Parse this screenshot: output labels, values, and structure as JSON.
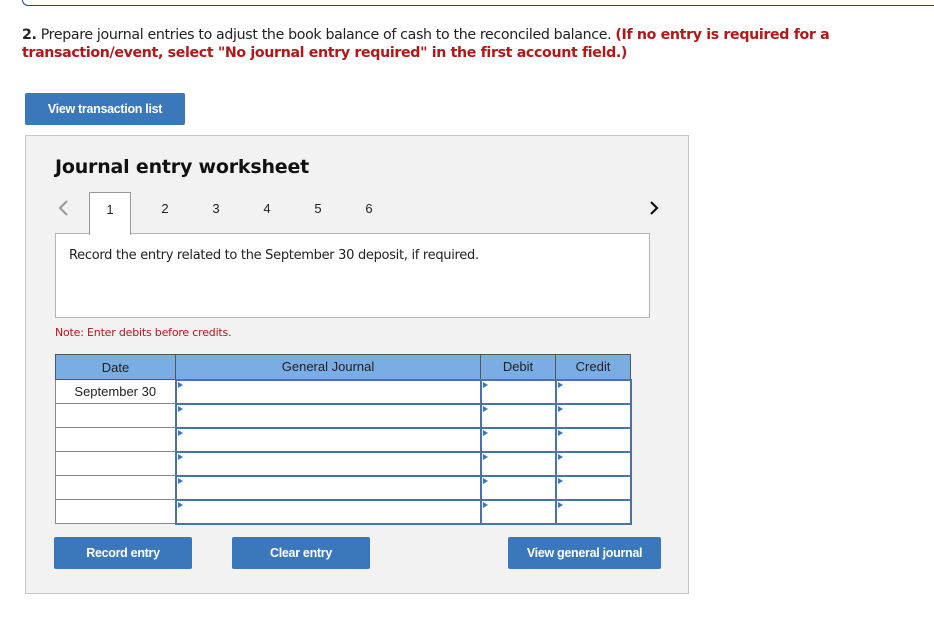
{
  "question": {
    "number": "2.",
    "text": " Prepare journal entries to adjust the book balance of cash to the reconciled balance. ",
    "instruction": "(If no entry is required for a transaction/event, select \"No journal entry required\" in the first account field.)"
  },
  "buttons": {
    "view_transaction_list": "View transaction list",
    "record_entry": "Record entry",
    "clear_entry": "Clear entry",
    "view_general_journal": "View general journal"
  },
  "worksheet": {
    "title": "Journal entry worksheet",
    "tabs": [
      "1",
      "2",
      "3",
      "4",
      "5",
      "6"
    ],
    "active_tab": "1",
    "prompt": "Record the entry related to the September 30 deposit, if required.",
    "note": "Note: Enter debits before credits."
  },
  "journal": {
    "headers": {
      "date": "Date",
      "account": "General Journal",
      "debit": "Debit",
      "credit": "Credit"
    },
    "rows": [
      {
        "date": "September 30",
        "account": "",
        "debit": "",
        "credit": ""
      },
      {
        "date": "",
        "account": "",
        "debit": "",
        "credit": ""
      },
      {
        "date": "",
        "account": "",
        "debit": "",
        "credit": ""
      },
      {
        "date": "",
        "account": "",
        "debit": "",
        "credit": ""
      },
      {
        "date": "",
        "account": "",
        "debit": "",
        "credit": ""
      },
      {
        "date": "",
        "account": "",
        "debit": "",
        "credit": ""
      }
    ]
  },
  "colors": {
    "button_blue": "#3a78bb",
    "header_blue": "#79ade3",
    "instruction_red": "#b31717"
  }
}
